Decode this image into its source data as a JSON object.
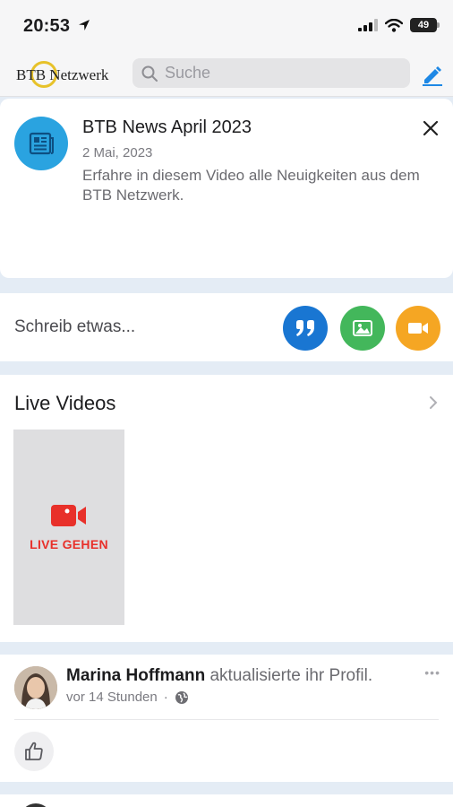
{
  "status": {
    "time": "20:53",
    "battery": "49"
  },
  "header": {
    "logo_text": "BTB Netzwerk",
    "search_placeholder": "Suche"
  },
  "news": {
    "title": "BTB News April 2023",
    "date": "2 Mai, 2023",
    "description": "Erfahre in diesem Video alle Neuigkeiten aus dem BTB Netzwerk."
  },
  "composer": {
    "prompt": "Schreib etwas..."
  },
  "live": {
    "title": "Live Videos",
    "tile_label": "LIVE GEHEN"
  },
  "post": {
    "author": "Marina Hoffmann",
    "action": "aktualisierte ihr Profil.",
    "time": "vor 14 Stunden",
    "separator": "·",
    "more": "•••"
  },
  "colors": {
    "accent_blue": "#1976d2",
    "news_icon": "#2aa3e0",
    "photo_green": "#43b75b",
    "video_orange": "#f5a623",
    "live_red": "#e8302a",
    "logo_ring": "#e7c22a",
    "feed_background": "#e4ecf5"
  },
  "icons": [
    "location-arrow-icon",
    "signal-icon",
    "wifi-icon",
    "battery-icon",
    "search-icon",
    "compose-icon",
    "news-icon",
    "close-icon",
    "quote-icon",
    "photo-icon",
    "video-icon",
    "chevron-right-icon",
    "video-camera-icon",
    "globe-icon",
    "thumbs-up-icon"
  ]
}
